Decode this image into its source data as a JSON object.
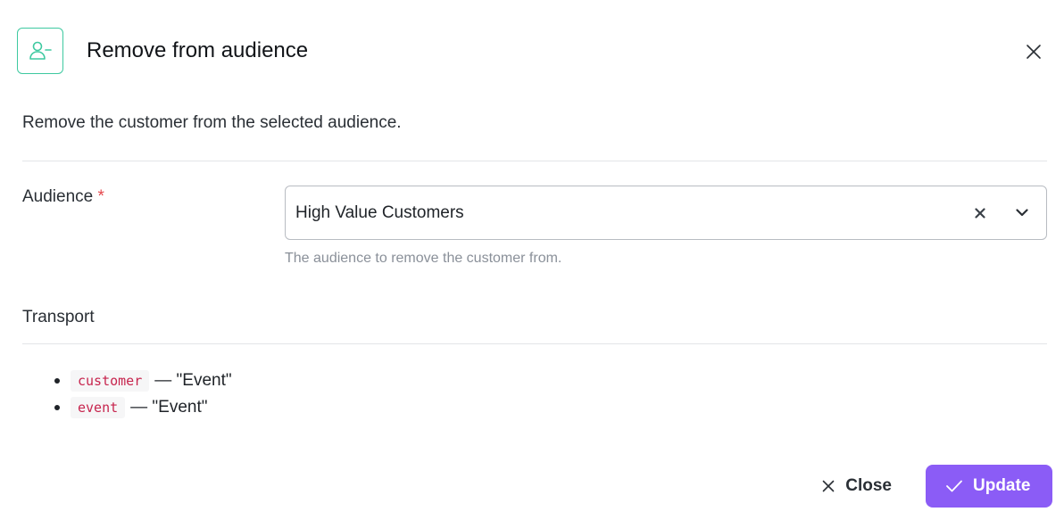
{
  "dialog": {
    "title": "Remove from audience",
    "description": "Remove the customer from the selected audience."
  },
  "audience_field": {
    "label": "Audience",
    "required_marker": "*",
    "value": "High Value Customers",
    "hint": "The audience to remove the customer from."
  },
  "transport": {
    "title": "Transport",
    "items": [
      {
        "code": "customer",
        "text": "— \"Event\""
      },
      {
        "code": "event",
        "text": "— \"Event\""
      }
    ]
  },
  "footer": {
    "close_label": "Close",
    "update_label": "Update"
  },
  "colors": {
    "accent": "#8b5cf6",
    "icon_teal": "#3ec9a0",
    "required": "#e5484d",
    "code_text": "#c7254e"
  },
  "icons": {
    "header": "user-minus-icon",
    "dismiss": "close-icon",
    "clear": "clear-icon",
    "dropdown": "chevron-down-icon",
    "update": "check-icon"
  }
}
